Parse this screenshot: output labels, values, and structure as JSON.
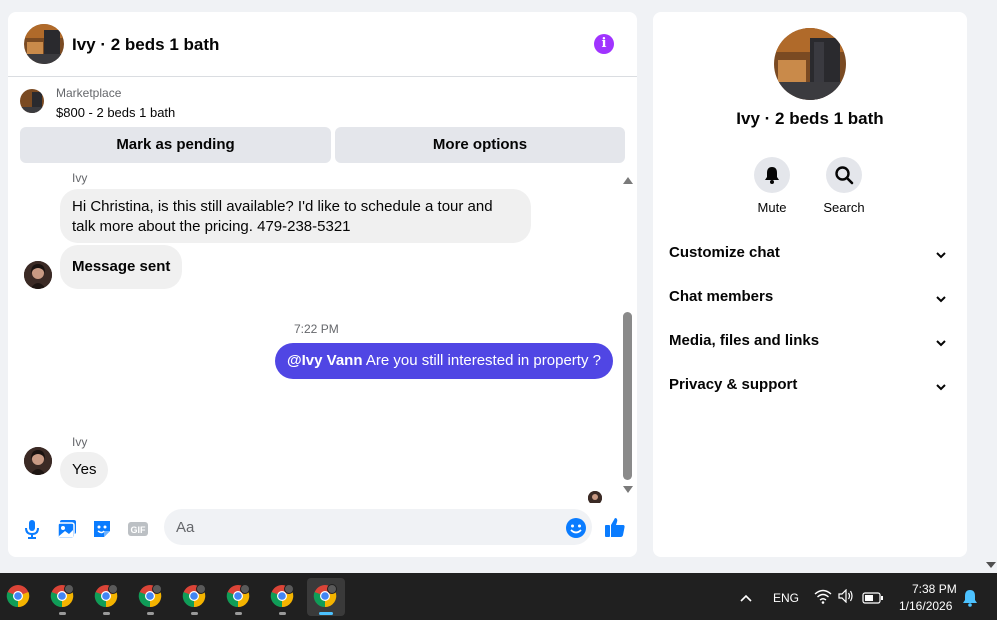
{
  "chat": {
    "title": "Ivy · 2 beds 1 bath",
    "listing": {
      "label": "Marketplace",
      "detail": "$800 - 2 beds 1 bath",
      "pending_button": "Mark as pending",
      "more_button": "More options"
    },
    "messages": {
      "sender_1": "Ivy",
      "msg_1": "Hi Christina, is this still available? I'd like to schedule a tour and talk more about the pricing. 479-238-5321",
      "msg_2": "Message sent",
      "timestamp": "7:22 PM",
      "out_mention": "@Ivy Vann",
      "out_text": " Are you still interested in property ?",
      "sender_2": "Ivy",
      "msg_3": "Yes"
    },
    "composer": {
      "placeholder": "Aa"
    }
  },
  "info_panel": {
    "name": "Ivy · 2 beds 1 bath",
    "actions": [
      {
        "label": "Mute",
        "icon": "bell-icon"
      },
      {
        "label": "Search",
        "icon": "search-icon"
      }
    ],
    "sections": [
      {
        "label": "Customize chat"
      },
      {
        "label": "Chat members"
      },
      {
        "label": "Media, files and links"
      },
      {
        "label": "Privacy & support"
      }
    ]
  },
  "taskbar": {
    "language": "ENG",
    "time": "7:38 PM",
    "date": "1/16/2026"
  },
  "colors": {
    "outgoing_bubble": "#5046e4",
    "accent_blue": "#0a7cff",
    "info_purple": "#a033ff",
    "taskbar_bg": "#202020"
  }
}
